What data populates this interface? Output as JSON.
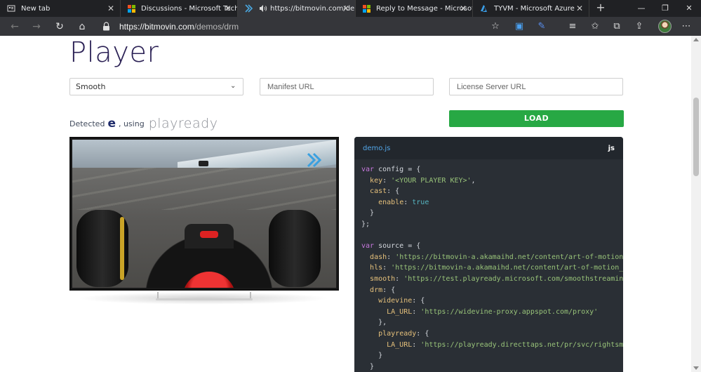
{
  "browser": {
    "tabs": [
      {
        "label": "New tab",
        "icon": "newtab-icon",
        "active": false
      },
      {
        "label": "Discussions - Microsoft Tech C",
        "icon": "microsoft-logo-icon",
        "active": false
      },
      {
        "label": "https://bitmovin.com/dem",
        "icon": "bitmovin-icon",
        "active": true,
        "audio": true
      },
      {
        "label": "Reply to Message - Microsoft T",
        "icon": "microsoft-logo-icon",
        "active": false
      },
      {
        "label": "TYVM - Microsoft Azure",
        "icon": "azure-icon",
        "active": false
      }
    ],
    "address": {
      "host": "https://bitmovin.com",
      "path": "/demos/drm"
    }
  },
  "page": {
    "title": "Player",
    "protocol_select": {
      "value": "Smooth"
    },
    "manifest_field": {
      "placeholder": "Manifest URL"
    },
    "license_field": {
      "placeholder": "License Server URL"
    },
    "detected": {
      "prefix": "Detected",
      "using": ", using",
      "drm": "playready"
    },
    "load_label": "LOAD"
  },
  "code_panel": {
    "filename": "demo.js",
    "lang": "js"
  },
  "colors": {
    "title": "#2b2155",
    "load_button": "#27a844",
    "code_bg": "#2a2f35",
    "code_file": "#52a6e8"
  }
}
